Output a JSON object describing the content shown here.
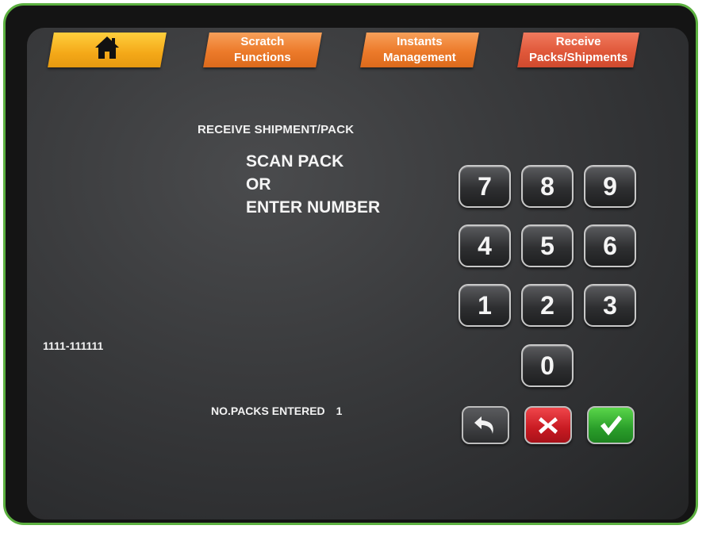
{
  "tabs": [
    {
      "id": "home",
      "icon": "home-icon",
      "label": ""
    },
    {
      "id": "scratch",
      "line1": "Scratch",
      "line2": "Functions"
    },
    {
      "id": "instants",
      "line1": "Instants",
      "line2": "Management"
    },
    {
      "id": "receive",
      "line1": "Receive",
      "line2": "Packs/Shipments"
    }
  ],
  "main": {
    "heading": "RECEIVE SHIPMENT/PACK",
    "prompt": [
      "SCAN PACK",
      "OR",
      "ENTER NUMBER"
    ],
    "pack_number": "1111-111111",
    "packs_entered_label": "NO.PACKS ENTERED",
    "packs_entered_count": "1"
  },
  "keypad": {
    "keys": [
      "7",
      "8",
      "9",
      "4",
      "5",
      "6",
      "1",
      "2",
      "3",
      "0"
    ],
    "actions": [
      {
        "id": "back",
        "icon": "back-arrow-icon"
      },
      {
        "id": "cancel",
        "icon": "close-icon"
      },
      {
        "id": "ok",
        "icon": "checkmark-icon"
      }
    ]
  },
  "colors": {
    "frame_border": "#5cb040",
    "tab_home": "#f4a818",
    "tab_orange": "#ec7a2a",
    "tab_red": "#e0583a",
    "cancel": "#c81a22",
    "ok": "#2a9e2a"
  }
}
